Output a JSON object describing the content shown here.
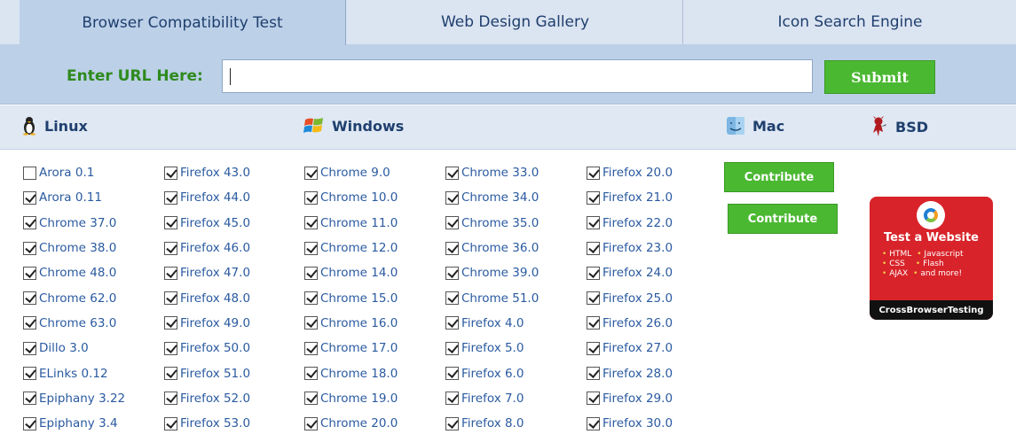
{
  "tabs": [
    {
      "label": "Browser Compatibility Test",
      "active": true
    },
    {
      "label": "Web Design Gallery",
      "active": false
    },
    {
      "label": "Icon Search Engine",
      "active": false
    }
  ],
  "url_form": {
    "label": "Enter URL Here:",
    "value": "",
    "placeholder": "",
    "submit_label": "Submit"
  },
  "os_headers": {
    "linux": "Linux",
    "windows": "Windows",
    "mac": "Mac",
    "bsd": "BSD"
  },
  "columns": [
    [
      {
        "label": "Arora 0.1",
        "checked": false
      },
      {
        "label": "Arora 0.11",
        "checked": true
      },
      {
        "label": "Chrome 37.0",
        "checked": true
      },
      {
        "label": "Chrome 38.0",
        "checked": true
      },
      {
        "label": "Chrome 48.0",
        "checked": true
      },
      {
        "label": "Chrome 62.0",
        "checked": true
      },
      {
        "label": "Chrome 63.0",
        "checked": true
      },
      {
        "label": "Dillo 3.0",
        "checked": true
      },
      {
        "label": "ELinks 0.12",
        "checked": true
      },
      {
        "label": "Epiphany 3.22",
        "checked": true
      },
      {
        "label": "Epiphany 3.4",
        "checked": true
      }
    ],
    [
      {
        "label": "Firefox 43.0",
        "checked": true
      },
      {
        "label": "Firefox 44.0",
        "checked": true
      },
      {
        "label": "Firefox 45.0",
        "checked": true
      },
      {
        "label": "Firefox 46.0",
        "checked": true
      },
      {
        "label": "Firefox 47.0",
        "checked": true
      },
      {
        "label": "Firefox 48.0",
        "checked": true
      },
      {
        "label": "Firefox 49.0",
        "checked": true
      },
      {
        "label": "Firefox 50.0",
        "checked": true
      },
      {
        "label": "Firefox 51.0",
        "checked": true
      },
      {
        "label": "Firefox 52.0",
        "checked": true
      },
      {
        "label": "Firefox 53.0",
        "checked": true
      }
    ],
    [
      {
        "label": "Chrome 9.0",
        "checked": true
      },
      {
        "label": "Chrome 10.0",
        "checked": true
      },
      {
        "label": "Chrome 11.0",
        "checked": true
      },
      {
        "label": "Chrome 12.0",
        "checked": true
      },
      {
        "label": "Chrome 14.0",
        "checked": true
      },
      {
        "label": "Chrome 15.0",
        "checked": true
      },
      {
        "label": "Chrome 16.0",
        "checked": true
      },
      {
        "label": "Chrome 17.0",
        "checked": true
      },
      {
        "label": "Chrome 18.0",
        "checked": true
      },
      {
        "label": "Chrome 19.0",
        "checked": true
      },
      {
        "label": "Chrome 20.0",
        "checked": true
      }
    ],
    [
      {
        "label": "Chrome 33.0",
        "checked": true
      },
      {
        "label": "Chrome 34.0",
        "checked": true
      },
      {
        "label": "Chrome 35.0",
        "checked": true
      },
      {
        "label": "Chrome 36.0",
        "checked": true
      },
      {
        "label": "Chrome 39.0",
        "checked": true
      },
      {
        "label": "Chrome 51.0",
        "checked": true
      },
      {
        "label": "Firefox 4.0",
        "checked": true
      },
      {
        "label": "Firefox 5.0",
        "checked": true
      },
      {
        "label": "Firefox 6.0",
        "checked": true
      },
      {
        "label": "Firefox 7.0",
        "checked": true
      },
      {
        "label": "Firefox 8.0",
        "checked": true
      }
    ],
    [
      {
        "label": "Firefox 20.0",
        "checked": true
      },
      {
        "label": "Firefox 21.0",
        "checked": true
      },
      {
        "label": "Firefox 22.0",
        "checked": true
      },
      {
        "label": "Firefox 23.0",
        "checked": true
      },
      {
        "label": "Firefox 24.0",
        "checked": true
      },
      {
        "label": "Firefox 25.0",
        "checked": true
      },
      {
        "label": "Firefox 26.0",
        "checked": true
      },
      {
        "label": "Firefox 27.0",
        "checked": true
      },
      {
        "label": "Firefox 28.0",
        "checked": true
      },
      {
        "label": "Firefox 29.0",
        "checked": true
      },
      {
        "label": "Firefox 30.0",
        "checked": true
      }
    ]
  ],
  "contribute_buttons": [
    "Contribute",
    "Contribute"
  ],
  "ad": {
    "title": "Test a Website",
    "items": [
      [
        "HTML",
        "Javascript"
      ],
      [
        "CSS",
        "Flash"
      ],
      [
        "AJAX",
        "and more!"
      ]
    ],
    "brand": "CrossBrowserTesting"
  },
  "colors": {
    "accent_green": "#4bb832",
    "label_green": "#2e8a1d",
    "link_blue": "#2a5aa0",
    "header_blue": "#bcd0e8",
    "ad_red": "#d8232a"
  },
  "icons": {
    "linux": "penguin-icon",
    "windows": "windows-flag-icon",
    "mac": "mac-finder-icon",
    "bsd": "bsd-daemon-icon",
    "checkbox": "checkmark-icon"
  }
}
